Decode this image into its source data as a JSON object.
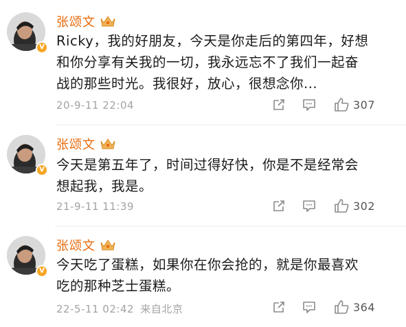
{
  "posts": [
    {
      "username": "张颂文",
      "content_lines": [
        "Ricky，我的好朋友，今天是你走后的第四年，好想",
        "和你分享有关我的一切，我永远忘不了我们一起奋",
        "战的那些时光。我很好，放心，很想念你..."
      ],
      "timestamp": "20-9-11 22:04",
      "source": "",
      "likes": "307"
    },
    {
      "username": "张颂文",
      "content_lines": [
        "今天是第五年了，时间过得好快，你是不是经常会",
        "想起我，我是。"
      ],
      "timestamp": "21-9-11 11:39",
      "source": "",
      "likes": "302"
    },
    {
      "username": "张颂文",
      "content_lines": [
        "今天吃了蛋糕，如果你在你会抢的，就是你最喜欢",
        "吃的那种芝士蛋糕。"
      ],
      "timestamp": "22-5-11 02:42",
      "source": "来自北京",
      "likes": "364"
    }
  ],
  "icons": {
    "verified": "verified-v-icon",
    "badge": "crown-badge-icon",
    "share": "share-icon",
    "comment": "comment-icon",
    "like": "thumbs-up-icon"
  },
  "colors": {
    "username": "#e86b0c",
    "meta": "#a3a3a3",
    "verified": "#f5a623",
    "icon": "#8a8a8a"
  }
}
